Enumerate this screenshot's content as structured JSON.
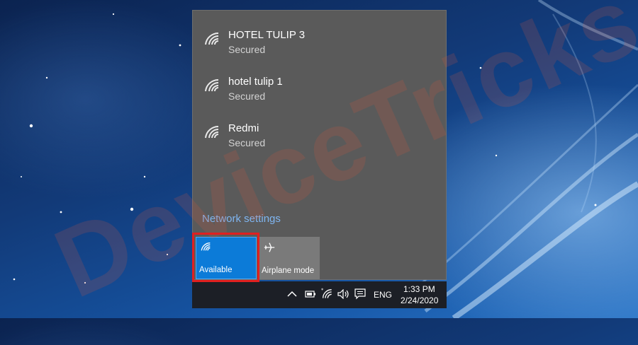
{
  "networks": [
    {
      "name": "HOTEL TULIP 3",
      "status": "Secured",
      "icon": "wifi-icon"
    },
    {
      "name": "hotel tulip 1",
      "status": "Secured",
      "icon": "wifi-icon"
    },
    {
      "name": "Redmi",
      "status": "Secured",
      "icon": "wifi-icon"
    }
  ],
  "network_settings_label": "Network settings",
  "quick_actions": {
    "wifi": {
      "label": "Available",
      "icon": "wifi-icon",
      "state": "on"
    },
    "airplane": {
      "label": "Airplane mode",
      "icon": "airplane-icon",
      "state": "off"
    }
  },
  "taskbar": {
    "language": "ENG",
    "time": "1:33 PM",
    "date": "2/24/2020"
  },
  "watermark": "DeviceTricks",
  "colors": {
    "accent": "#0c7bd8",
    "link": "#7fb6f2",
    "highlight": "#e02020",
    "flyout_bg": "#5a5a5a",
    "taskbar_bg": "#1c1f26"
  }
}
